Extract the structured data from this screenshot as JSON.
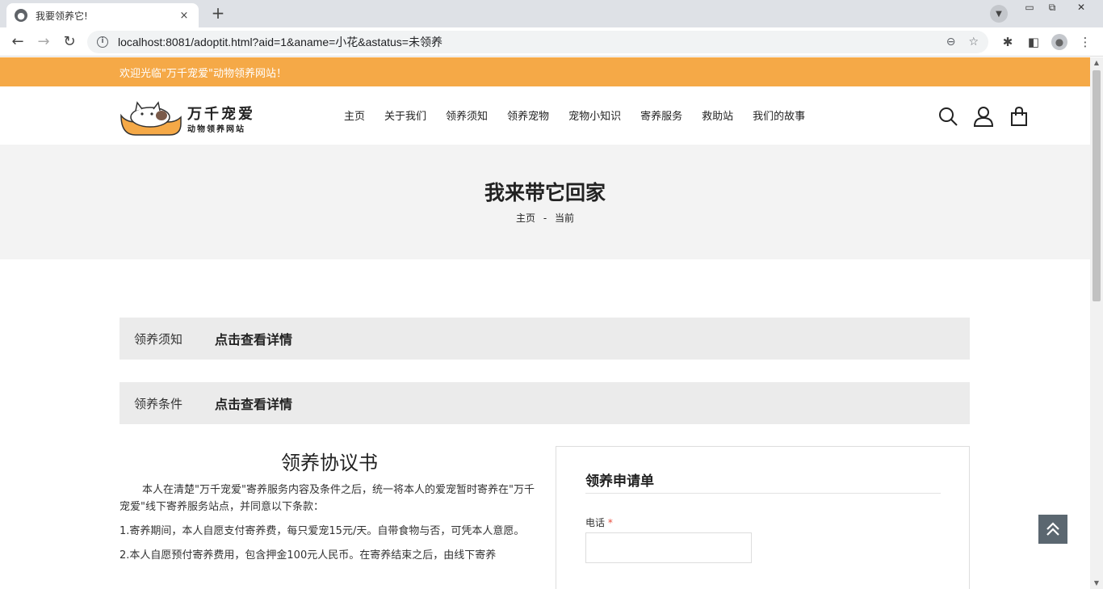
{
  "browser": {
    "tab_title": "我要领养它!",
    "tab_close": "×",
    "new_tab": "+",
    "url": "localhost:8081/adoptit.html?aid=1&aname=小花&astatus=未领养",
    "icons": [
      "back-icon",
      "forward-icon",
      "reload-icon",
      "info-icon",
      "zoom-icon",
      "star-icon",
      "extensions-icon",
      "sidepanel-icon",
      "profile-icon",
      "menu-icon"
    ]
  },
  "site": {
    "welcome": "欢迎光临\"万千宠爱\"动物领养网站！",
    "logo_main": "万千宠爱",
    "logo_sub": "动物领养网站",
    "nav": [
      {
        "label": "主页"
      },
      {
        "label": "关于我们"
      },
      {
        "label": "领养须知"
      },
      {
        "label": "领养宠物"
      },
      {
        "label": "宠物小知识"
      },
      {
        "label": "寄养服务"
      },
      {
        "label": "救助站"
      },
      {
        "label": "我们的故事"
      }
    ],
    "accent_color": "#f5a947"
  },
  "banner": {
    "title": "我来带它回家",
    "crumb_home": "主页",
    "crumb_sep": "-",
    "crumb_current": "当前"
  },
  "accordions": [
    {
      "label": "领养须知",
      "link": "点击查看详情"
    },
    {
      "label": "领养条件",
      "link": "点击查看详情"
    }
  ],
  "agreement": {
    "title": "领养协议书",
    "paragraphs": [
      "本人在清楚\"万千宠爱\"寄养服务内容及条件之后，统一将本人的爱宠暂时寄养在\"万千宠爱\"线下寄养服务站点，并同意以下条款：",
      "1.寄养期间，本人自愿支付寄养费，每只爱宠15元/天。自带食物与否，可凭本人意愿。",
      "2.本人自愿预付寄养费用，包含押金100元人民币。在寄养结束之后，由线下寄养"
    ]
  },
  "form": {
    "title": "领养申请单",
    "phone_label": "电话",
    "required_mark": "*",
    "phone_value": ""
  }
}
